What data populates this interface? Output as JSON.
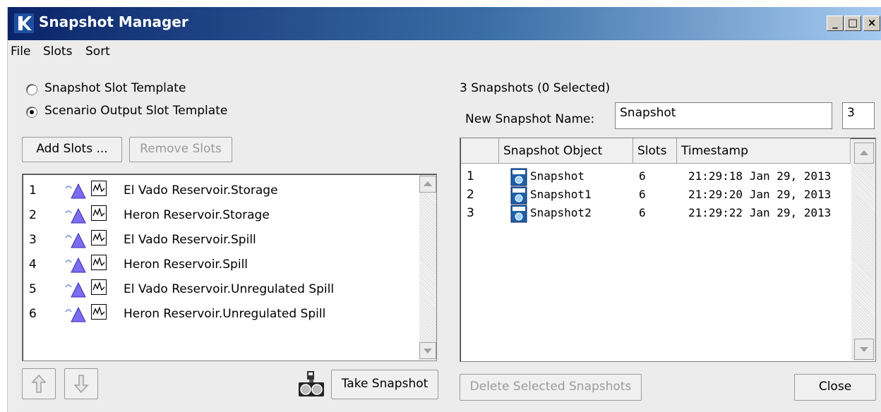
{
  "window": {
    "title": "Snapshot Manager",
    "minimize_label": "_",
    "maximize_label": "□",
    "close_label": "×"
  },
  "menu": [
    "File",
    "Slots",
    "Sort"
  ],
  "left": {
    "radio_snapshot_template": "Snapshot Slot Template",
    "radio_scenario_template": "Scenario Output Slot Template",
    "selected_radio": "Scenario Output Slot Template",
    "add_slots_label": "Add Slots ...",
    "remove_slots_label": "Remove Slots",
    "slots": [
      {
        "index": "1",
        "name": "El Vado Reservoir.Storage"
      },
      {
        "index": "2",
        "name": "Heron Reservoir.Storage"
      },
      {
        "index": "3",
        "name": "El Vado Reservoir.Spill"
      },
      {
        "index": "4",
        "name": "Heron Reservoir.Spill"
      },
      {
        "index": "5",
        "name": "El Vado Reservoir.Unregulated Spill"
      },
      {
        "index": "6",
        "name": "Heron Reservoir.Unregulated Spill"
      }
    ],
    "take_snapshot_label": "Take Snapshot"
  },
  "right": {
    "summary": "3 Snapshots (0 Selected)",
    "new_name_label": "New Snapshot Name:",
    "new_name_value": "Snapshot",
    "new_name_counter": "3",
    "columns": [
      "",
      "Snapshot Object",
      "Slots",
      "Timestamp"
    ],
    "rows": [
      {
        "index": "1",
        "object": "Snapshot",
        "slots": "6",
        "timestamp": "21:29:18 Jan 29, 2013"
      },
      {
        "index": "2",
        "object": "Snapshot1",
        "slots": "6",
        "timestamp": "21:29:20 Jan 29, 2013"
      },
      {
        "index": "3",
        "object": "Snapshot2",
        "slots": "6",
        "timestamp": "21:29:22 Jan 29, 2013"
      }
    ],
    "delete_label": "Delete Selected Snapshots",
    "close_label": "Close"
  },
  "colors": {
    "title_gradient_start": "#0a246a",
    "title_gradient_end": "#a6caf0",
    "triangle_icon": "#7b6cf0",
    "snapshot_icon": "#1f5fa8"
  }
}
